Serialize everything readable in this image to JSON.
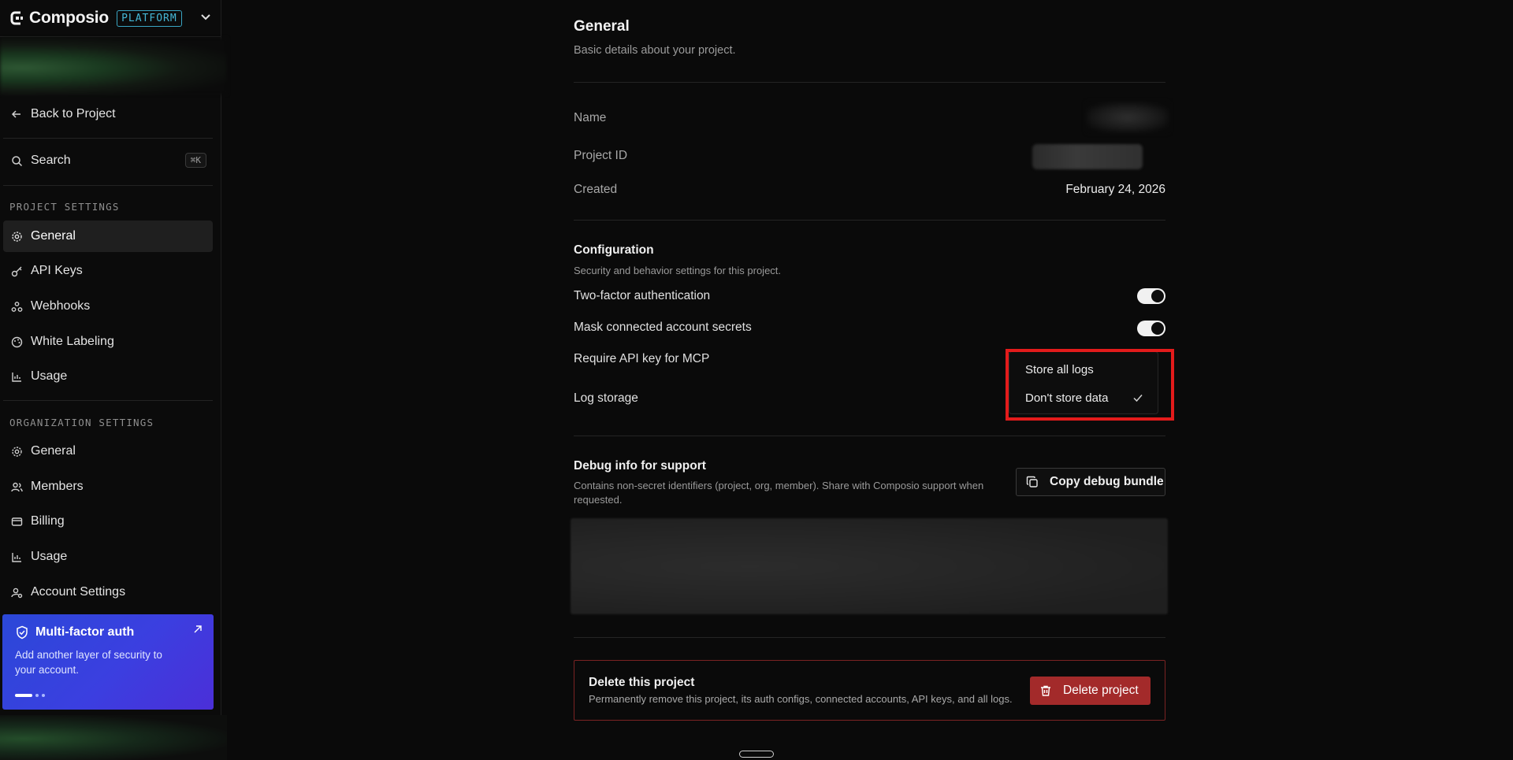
{
  "brand": {
    "name": "Composio",
    "tag": "PLATFORM"
  },
  "sidebar": {
    "back_label": "Back to Project",
    "search_label": "Search",
    "search_shortcut": "⌘K",
    "project_section": "PROJECT SETTINGS",
    "project_items": [
      {
        "label": "General",
        "icon": "gear-icon",
        "active": true
      },
      {
        "label": "API Keys",
        "icon": "key-icon"
      },
      {
        "label": "Webhooks",
        "icon": "webhook-icon"
      },
      {
        "label": "White Labeling",
        "icon": "palette-icon"
      },
      {
        "label": "Usage",
        "icon": "chart-icon"
      }
    ],
    "org_section": "ORGANIZATION SETTINGS",
    "org_items": [
      {
        "label": "General",
        "icon": "gear-icon"
      },
      {
        "label": "Members",
        "icon": "users-icon"
      },
      {
        "label": "Billing",
        "icon": "card-icon"
      },
      {
        "label": "Usage",
        "icon": "chart-icon"
      },
      {
        "label": "Account Settings",
        "icon": "user-cog-icon"
      }
    ],
    "promo": {
      "title": "Multi-factor auth",
      "description": "Add another layer of security to your account."
    }
  },
  "general": {
    "title": "General",
    "subtitle": "Basic details about your project.",
    "name_label": "Name",
    "project_id_label": "Project ID",
    "created_label": "Created",
    "created_value": "February 24, 2026"
  },
  "configuration": {
    "title": "Configuration",
    "description": "Security and behavior settings for this project.",
    "two_factor_label": "Two-factor authentication",
    "two_factor_on": true,
    "mask_secrets_label": "Mask connected account secrets",
    "mask_secrets_on": true,
    "require_api_key_label": "Require API key for MCP",
    "log_storage_label": "Log storage",
    "log_storage_options": [
      "Store all logs",
      "Don't store data"
    ],
    "log_storage_selected": "Don't store data"
  },
  "debug": {
    "title": "Debug info for support",
    "description_line1": "Contains non-secret identifiers (project, org, member). Share with Composio support when",
    "description_line2": "requested.",
    "copy_button": "Copy debug bundle"
  },
  "danger": {
    "title": "Delete this project",
    "description": "Permanently remove this project, its auth configs, connected accounts, API keys, and all logs.",
    "button": "Delete project"
  },
  "colors": {
    "accent": "#45b7d6",
    "danger": "#a32a2a",
    "highlight": "#e31b1b",
    "promo": "#3b3fe0"
  }
}
